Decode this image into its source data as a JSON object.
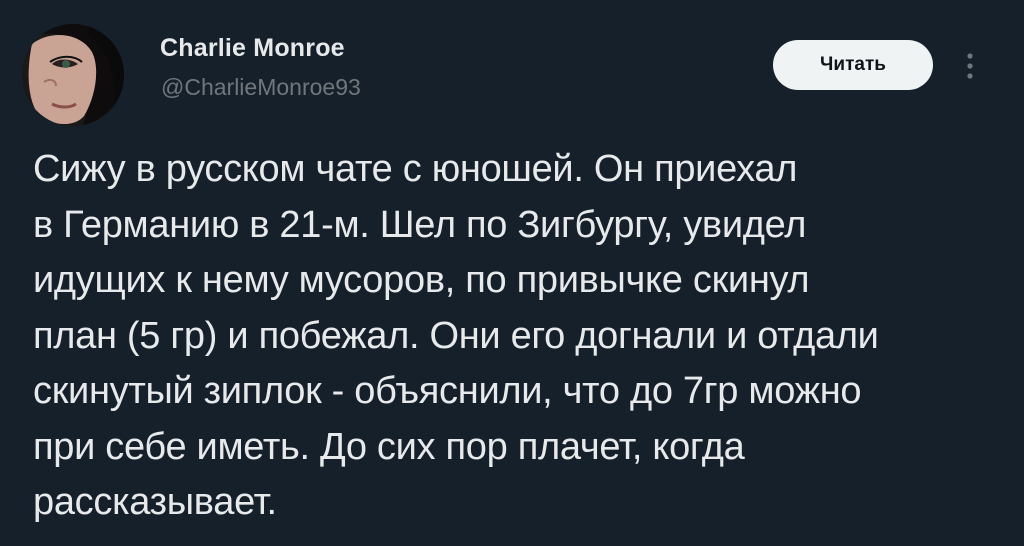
{
  "author": {
    "display_name": "Charlie Monroe",
    "handle": "@CharlieMonroe93"
  },
  "actions": {
    "follow_label": "Читать",
    "more_icon": "vertical-ellipsis-icon"
  },
  "tweet": {
    "lines": [
      "Сижу в русском чате с юношей. Он приехал",
      "в Германию в 21-м. Шел по Зигбургу, увидел",
      "идущих к нему мусоров, по привычке скинул",
      "план (5 гр) и побежал. Они его догнали и отдали",
      "скинутый зиплок - объяснили, что до 7гр можно",
      "при себе иметь. До сих пор плачет, когда",
      "рассказывает."
    ]
  },
  "colors": {
    "background": "#15202b",
    "primary_text": "#e7e9ea",
    "secondary_text": "#71767b",
    "button_bg": "#eff3f4",
    "button_text": "#0f1419"
  }
}
